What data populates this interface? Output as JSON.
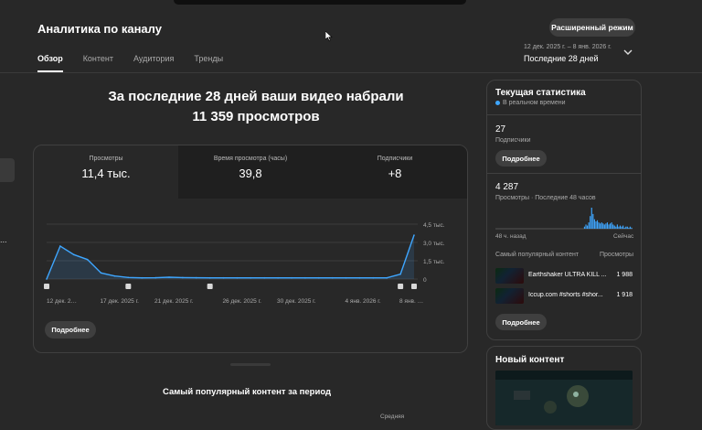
{
  "header": {
    "title": "Аналитика по каналу",
    "tabs": [
      "Обзор",
      "Контент",
      "Аудитория",
      "Тренды"
    ],
    "advanced_button": "Расширенный режим",
    "date_range": "12 дек. 2025 г. – 8 янв. 2026 г.",
    "period": "Последние 28 дней"
  },
  "overview": {
    "headline_line1": "За последние 28 дней ваши видео набрали",
    "headline_line2": "11 359 просмотров",
    "metrics": [
      {
        "label": "Просмотры",
        "value": "11,4 тыс."
      },
      {
        "label": "Время просмотра (часы)",
        "value": "39,8"
      },
      {
        "label": "Подписчики",
        "value": "+8"
      }
    ],
    "more_button": "Подробнее"
  },
  "chart_data": {
    "type": "area",
    "x_tick_labels": [
      "12 дек. 2…",
      "17 дек. 2025 г.",
      "21 дек. 2025 г.",
      "26 дек. 2025 г.",
      "30 дек. 2025 г.",
      "4 янв. 2026 г.",
      "8 янв. …"
    ],
    "y_tick_labels": [
      "4,5 тыс.",
      "3,0 тыс.",
      "1,5 тыс.",
      "0"
    ],
    "ylim": [
      0,
      4500
    ],
    "values": [
      0,
      2700,
      2000,
      1600,
      500,
      250,
      130,
      100,
      110,
      150,
      120,
      110,
      100,
      100,
      100,
      100,
      100,
      100,
      100,
      100,
      100,
      100,
      100,
      100,
      100,
      100,
      400,
      3600
    ],
    "line_color": "#3ea6ff"
  },
  "realtime": {
    "title": "Текущая статистика",
    "live_label": "В реальном времени",
    "subscribers_value": "27",
    "subscribers_label": "Подписчики",
    "more_button_1": "Подробнее",
    "views_value": "4 287",
    "views_label": "Просмотры · Последние 48 часов",
    "bars": [
      0,
      0,
      0,
      0,
      0,
      0,
      0,
      0,
      0,
      0,
      0,
      0,
      0,
      0,
      0,
      0,
      0,
      0,
      0,
      0,
      0,
      0,
      0,
      0,
      0,
      0,
      0,
      0,
      0,
      0,
      0,
      0,
      0,
      0,
      0,
      0,
      0,
      0,
      0,
      0,
      0,
      0,
      0,
      0,
      0,
      0,
      0,
      0,
      0,
      0,
      0,
      0,
      0,
      0,
      0,
      0,
      0,
      0,
      0,
      0,
      0,
      0,
      0.1,
      0.2,
      0.15,
      0.3,
      0.6,
      1,
      0.7,
      0.45,
      0.35,
      0.4,
      0.3,
      0.25,
      0.3,
      0.25,
      0.2,
      0.25,
      0.3,
      0.2,
      0.25,
      0.3,
      0.2,
      0.15,
      0.1,
      0.2,
      0.1,
      0.15,
      0.1,
      0.15,
      0.05,
      0.1,
      0.1,
      0.05,
      0.1,
      0.05
    ],
    "bars_color": "#3ea6ff",
    "axis_left": "48 ч. назад",
    "axis_right": "Сейчас",
    "top_content_label": "Самый популярный контент",
    "top_views_label": "Просмотры",
    "top_items": [
      {
        "title": "Earthshaker ULTRA KILL ...",
        "views": "1 988"
      },
      {
        "title": "Iccup.com #shorts #shor...",
        "views": "1 918"
      }
    ],
    "more_button_2": "Подробнее"
  },
  "new_content": {
    "title": "Новый контент"
  },
  "popular": {
    "title": "Самый популярный контент за период",
    "avg_label": "Средняя"
  }
}
